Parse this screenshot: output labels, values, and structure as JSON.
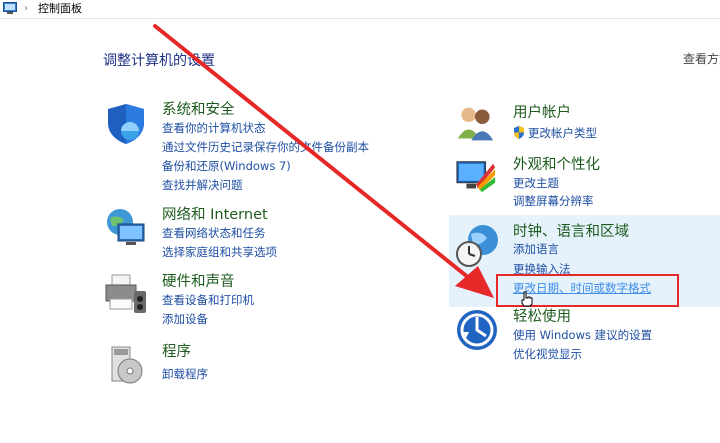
{
  "address": {
    "crumb": "控制面板",
    "separator": "›"
  },
  "main": {
    "title": "调整计算机的设置",
    "view_by": "查看方式："
  },
  "categories": {
    "system": {
      "title": "系统和安全",
      "links": [
        "查看你的计算机状态",
        "通过文件历史记录保存你的文件备份副本",
        "备份和还原(Windows 7)",
        "查找并解决问题"
      ]
    },
    "network": {
      "title": "网络和 Internet",
      "links": [
        "查看网络状态和任务",
        "选择家庭组和共享选项"
      ]
    },
    "hardware": {
      "title": "硬件和声音",
      "links": [
        "查看设备和打印机",
        "添加设备"
      ]
    },
    "programs": {
      "title": "程序",
      "links": [
        "卸载程序"
      ]
    },
    "users": {
      "title": "用户帐户",
      "links": [
        "更改帐户类型"
      ]
    },
    "appearance": {
      "title": "外观和个性化",
      "links": [
        "更改主题",
        "调整屏幕分辨率"
      ]
    },
    "clock": {
      "title": "时钟、语言和区域",
      "links": [
        "添加语言",
        "更换输入法",
        "更改日期、时间或数字格式"
      ]
    },
    "ease": {
      "title": "轻松使用",
      "links": [
        "使用 Windows 建议的设置",
        "优化视觉显示"
      ]
    }
  },
  "colors": {
    "link": "#1f4fa3",
    "category_title": "#1e5b1e",
    "highlight": "#e5f1fb",
    "annotation_red": "#e62828"
  }
}
